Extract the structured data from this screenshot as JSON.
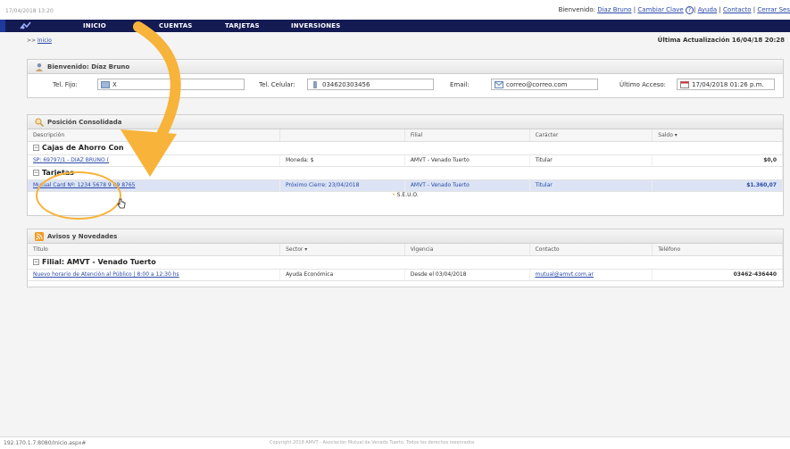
{
  "topbar": {
    "datetime": "17/04/2018 13:20",
    "welcome_prefix": "Bienvenido:",
    "user_name": "Diaz Bruno",
    "change_password": "Cambiar Clave",
    "help": "Ayuda",
    "contact": "Contacto",
    "logout": "Cerrar Ses"
  },
  "nav": {
    "items": [
      "INICIO",
      "CUENTAS",
      "TARJETAS",
      "INVERSIONES"
    ]
  },
  "breadcrumb": {
    "prefix": ">>",
    "home": "Inicio"
  },
  "last_update": "Última Actualización 16/04/18 20:28",
  "profile": {
    "title": "Bienvenido: Díaz Bruno",
    "tel_fijo_label": "Tel. Fijo:",
    "tel_fijo_value": "X",
    "tel_celular_label": "Tel. Celular:",
    "tel_celular_value": "034620303456",
    "email_label": "Email:",
    "email_value": "correo@correo.com",
    "ultimo_acceso_label": "Último Acceso:",
    "ultimo_acceso_value": "17/04/2018 01:26 p.m."
  },
  "posicion": {
    "title": "Posición Consolidada",
    "columns": [
      "Descripción",
      "",
      "Filial",
      "Carácter",
      "Saldo ▾"
    ],
    "groups": [
      {
        "name": "Cajas de Ahorro Con",
        "rows": [
          {
            "desc": "SP: 69797/1 - DIAZ BRUNO (",
            "extra": "Moneda: $",
            "filial": "AMVT - Venado Tuerto",
            "caracter": "Titular",
            "saldo": "$0,0"
          }
        ]
      },
      {
        "name": "Tarjetas",
        "rows": [
          {
            "desc": "Mutual Card Nº: 1234 5678 9 09 8765",
            "extra": "Próximo Cierre: 23/04/2018",
            "filial": "AMVT - Venado Tuerto",
            "caracter": "Titular",
            "saldo": "$1.360,07"
          }
        ]
      }
    ],
    "footer": "S.E.U.O."
  },
  "avisos": {
    "title": "Avisos y Novedades",
    "columns": [
      "Título",
      "Sector ▾",
      "Vigencia",
      "Contacto",
      "Teléfono"
    ],
    "group": "Filial: AMVT - Venado Tuerto",
    "rows": [
      {
        "titulo": "Nuevo horario de Atención al Público | 8:00 a 12:30 hs",
        "sector": "Ayuda Económica",
        "vigencia": "Desde el 03/04/2018",
        "contacto": "mutual@amvt.com.ar",
        "telefono": "03462-436440"
      }
    ]
  },
  "status": {
    "url": "192.170.1.7:8080/Inicio.aspx#",
    "copyright": "Copyright 2018 AMVT - Asociación Mutual de Venado Tuerto. Todos los derechos reservados"
  },
  "colors": {
    "nav_bg": "#141a52",
    "annotation": "#f7b33a",
    "link": "#2a4aa8"
  }
}
